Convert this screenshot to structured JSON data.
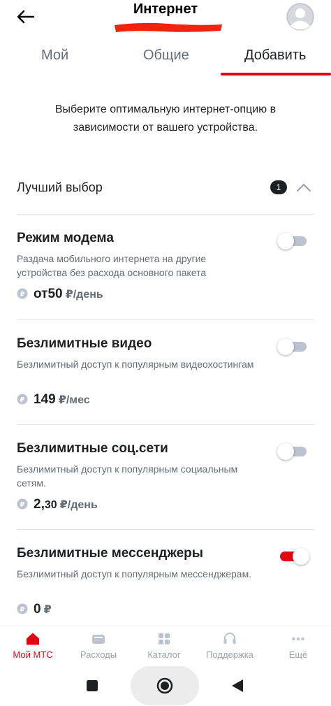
{
  "header": {
    "title": "Интернет"
  },
  "tabs": [
    {
      "label": "Мой",
      "active": false
    },
    {
      "label": "Общие",
      "active": false
    },
    {
      "label": "Добавить",
      "active": true
    }
  ],
  "intro": "Выберите оптимальную интернет-опцию в зависимости от вашего устройства.",
  "section": {
    "title": "Лучший выбор",
    "badge": "1"
  },
  "options": [
    {
      "title": "Режим модема",
      "description": "Раздача мобильного интернета на другие устройства без расхода основного пакета",
      "price_prefix": "от ",
      "price": "50",
      "price_frac": "",
      "price_unit": "₽/день",
      "enabled": false
    },
    {
      "title": "Безлимитные видео",
      "description": "Безлимитный доступ к популярным видеохостингам",
      "price_prefix": "",
      "price": "149",
      "price_frac": "",
      "price_unit": "₽/мес",
      "enabled": false
    },
    {
      "title": "Безлимитные соц.сети",
      "description": "Безлимитный доступ к популярным социальным сетям.",
      "price_prefix": "",
      "price": "2,",
      "price_frac": "30",
      "price_unit": "₽/день",
      "enabled": false
    },
    {
      "title": "Безлимитные мессенджеры",
      "description": "Безлимитный доступ к популярным мессенджерам.",
      "price_prefix": "",
      "price": "0",
      "price_frac": "",
      "price_unit": "₽",
      "enabled": true
    }
  ],
  "bottom_nav": [
    {
      "label": "Мой МТС",
      "icon": "home-icon",
      "active": true
    },
    {
      "label": "Расходы",
      "icon": "wallet-icon",
      "active": false
    },
    {
      "label": "Каталог",
      "icon": "grid-icon",
      "active": false
    },
    {
      "label": "Поддержка",
      "icon": "headset-icon",
      "active": false
    },
    {
      "label": "Ещё",
      "icon": "more-icon",
      "active": false
    }
  ],
  "colors": {
    "accent": "#e30611",
    "text": "#1d2023",
    "secondary": "#626c77",
    "toggle_off": "#bcc3d0"
  }
}
